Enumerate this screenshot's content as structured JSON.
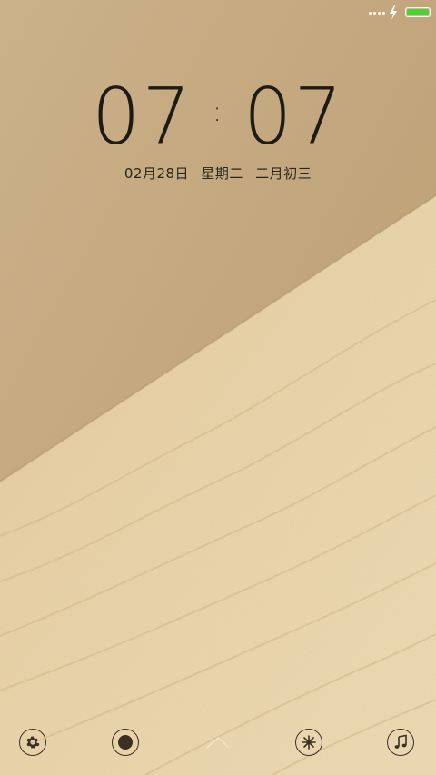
{
  "status_bar": {
    "icons": [
      "signal-dots-icon",
      "charging-bolt-icon",
      "battery-icon"
    ],
    "battery_level": 1.0,
    "battery_color": "#4cd137"
  },
  "lockscreen": {
    "hour": "07",
    "separator": ":",
    "minute": "07",
    "date": "02月28日",
    "weekday": "星期二",
    "lunar_date": "二月初三"
  },
  "bottom_shortcuts": {
    "left_1": "gear-icon",
    "left_2": "record-icon",
    "center": "chevron-up-icon",
    "right_1": "flower-icon",
    "right_2": "music-note-icon"
  },
  "colors": {
    "sand_dark": "#c9ad84",
    "sand_light": "#ecd5ab",
    "text": "#1e1a14"
  }
}
